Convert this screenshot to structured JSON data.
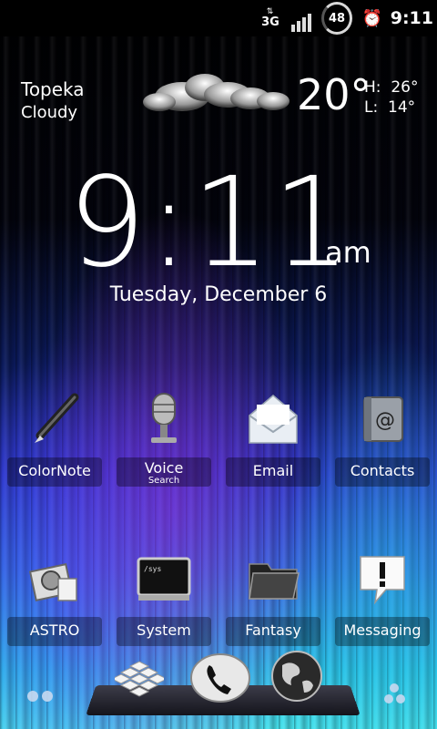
{
  "status_bar": {
    "network_label": "3G",
    "battery_percent": "48",
    "time": "9:11"
  },
  "weather": {
    "city": "Topeka",
    "condition": "Cloudy",
    "temperature": "20°",
    "high_label": "H:",
    "high_value": "26°",
    "low_label": "L:",
    "low_value": "14°"
  },
  "clock": {
    "time": "9:11",
    "ampm": "am",
    "date": "Tuesday, December 6"
  },
  "apps": [
    {
      "label": "ColorNote",
      "icon": "pen-icon"
    },
    {
      "label": "Voice",
      "sub": "Search",
      "icon": "microphone-icon"
    },
    {
      "label": "Email",
      "icon": "envelope-icon"
    },
    {
      "label": "Contacts",
      "icon": "address-book-icon"
    },
    {
      "label": "ASTRO",
      "icon": "file-manager-icon"
    },
    {
      "label": "System",
      "icon": "terminal-icon"
    },
    {
      "label": "Fantasy",
      "icon": "folder-icon"
    },
    {
      "label": "Messaging",
      "icon": "speech-bubble-icon"
    }
  ],
  "dock": {
    "items": [
      "app-drawer-icon",
      "phone-icon",
      "browser-globe-icon"
    ]
  },
  "colors": {
    "accent": "#2bc2e8",
    "violet": "#7a2ad8"
  }
}
